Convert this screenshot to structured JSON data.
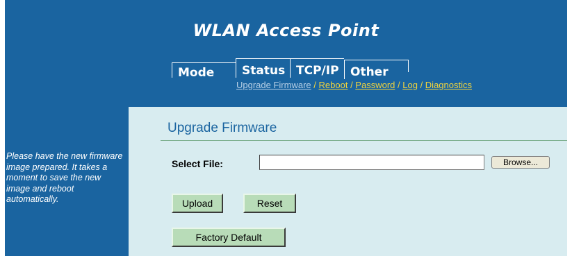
{
  "header": {
    "title": "WLAN Access Point"
  },
  "tabs": {
    "mode": "Mode",
    "status": "Status",
    "tcpip": "TCP/IP",
    "other": "Other"
  },
  "subnav": {
    "current": "Upgrade Firmware",
    "sep": "/",
    "reboot": "Reboot",
    "password": "Password",
    "log": "Log",
    "diagnostics": "Diagnostics"
  },
  "sidebar": {
    "note": "Please have the new firmware image prepared. It takes a moment to save the new image and reboot automatically."
  },
  "main": {
    "page_title": "Upgrade Firmware",
    "select_file_label": "Select File:",
    "file_value": "",
    "browse_label": "Browse...",
    "upload_label": "Upload",
    "reset_label": "Reset",
    "factory_default_label": "Factory Default"
  },
  "colors": {
    "frame": "#1a64a0",
    "content": "#d8ecf0",
    "link": "#f2d43c",
    "current_link": "#b6cfe6",
    "button": "#b8dcb8"
  }
}
